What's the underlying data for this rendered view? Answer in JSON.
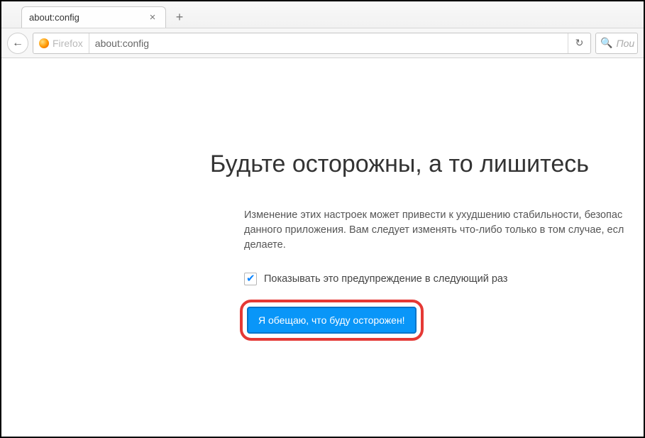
{
  "tab": {
    "title": "about:config",
    "close_glyph": "×"
  },
  "newtab_glyph": "+",
  "toolbar": {
    "back_glyph": "←",
    "identity_label": "Firefox",
    "url": "about:config",
    "reload_glyph": "↻"
  },
  "search": {
    "magnifier_glyph": "🔍",
    "placeholder": "Пои"
  },
  "warning": {
    "title": "Будьте осторожны, а то лишитесь",
    "body_line1": "Изменение этих настроек может привести к ухудшению стабильности, безопас",
    "body_line2": "данного приложения. Вам следует изменять что-либо только в том случае, есл",
    "body_line3": "делаете.",
    "checkbox_label": "Показывать это предупреждение в следующий раз",
    "button_label": "Я обещаю, что буду осторожен!"
  }
}
